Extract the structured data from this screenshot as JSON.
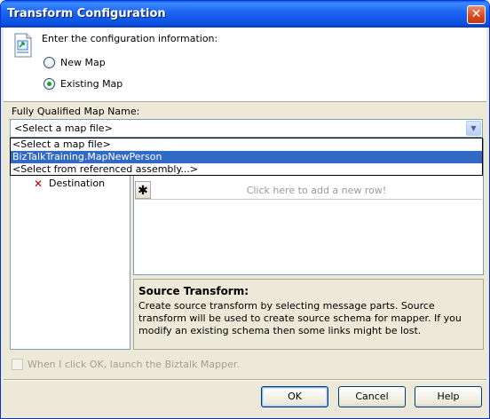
{
  "window": {
    "title": "Transform Configuration",
    "close_glyph": "✕"
  },
  "config": {
    "prompt": "Enter the configuration information:",
    "radio_new_label": "New Map",
    "radio_existing_label": "Existing Map",
    "selected_option": "Existing Map"
  },
  "map_name": {
    "label": "Fully Qualified Map Name:",
    "value": "<Select a map file>",
    "options": [
      "<Select a map file>",
      "BizTalkTraining.MapNewPerson",
      "<Select from referenced assembly...>"
    ],
    "highlighted_option": "BizTalkTraining.MapNewPerson"
  },
  "tree": {
    "item_destination": "Destination",
    "item_icon": "red-x-icon"
  },
  "grid": {
    "new_row_symbol": "✱",
    "new_row_placeholder": "Click here to add a new row!"
  },
  "info": {
    "title": "Source Transform:",
    "text": "Create source transform by selecting message parts. Source transform will be used to create source schema for mapper. If you modify an existing schema then some links might be lost."
  },
  "launch_checkbox": {
    "label": "When I click OK, launch the Biztalk Mapper.",
    "checked": false,
    "enabled": false
  },
  "buttons": {
    "ok": "OK",
    "cancel": "Cancel",
    "help": "Help"
  },
  "colors": {
    "title_bar": "#0a4fe0",
    "dialog_bg": "#ece9d8",
    "selection": "#316ac5",
    "radio_dot": "#21a121"
  }
}
